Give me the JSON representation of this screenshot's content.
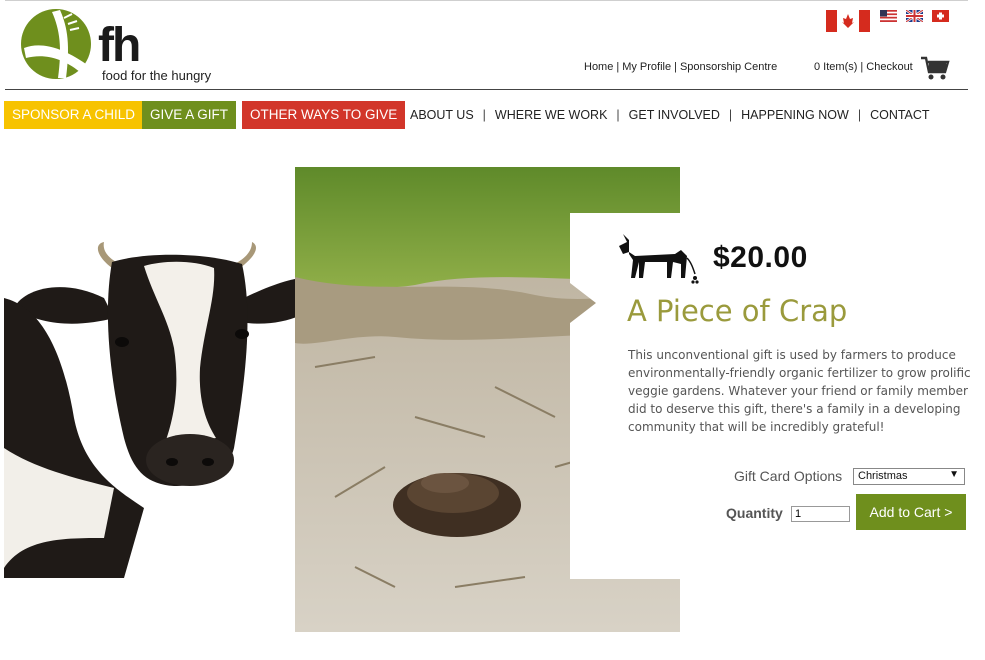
{
  "header": {
    "logo_text": "fh",
    "logo_tagline": "food for the hungry",
    "utility_nav": [
      "Home",
      "My Profile",
      "Sponsorship Centre"
    ],
    "cart_count": "0 Item(s)",
    "checkout": "Checkout",
    "separator": "|"
  },
  "flags": [
    "canada-flag",
    "usa-flag",
    "uk-flag",
    "switzerland-flag"
  ],
  "nav": {
    "sponsor": "SPONSOR A CHILD",
    "gift": "GIVE A GIFT",
    "other": "OTHER WAYS TO GIVE",
    "links": [
      "ABOUT US",
      "WHERE WE WORK",
      "GET INVOLVED",
      "HAPPENING NOW",
      "CONTACT"
    ],
    "separator": "|"
  },
  "product": {
    "price": "$20.00",
    "title": "A Piece of Crap",
    "description": "This unconventional gift is used by farmers to produce environmentally-friendly organic fertilizer to grow prolific veggie gardens. Whatever your friend or family member did to deserve this gift, there's a family in a developing community that will be incredibly grateful!",
    "gift_card_label": "Gift Card Options",
    "gift_card_selected": "Christmas",
    "quantity_label": "Quantity",
    "quantity_value": "1",
    "add_to_cart": "Add to Cart >"
  },
  "colors": {
    "sponsor": "#f7c300",
    "gift": "#6f8f1d",
    "other": "#d2362a",
    "title": "#9a9a3c",
    "button": "#6f8f1d"
  }
}
